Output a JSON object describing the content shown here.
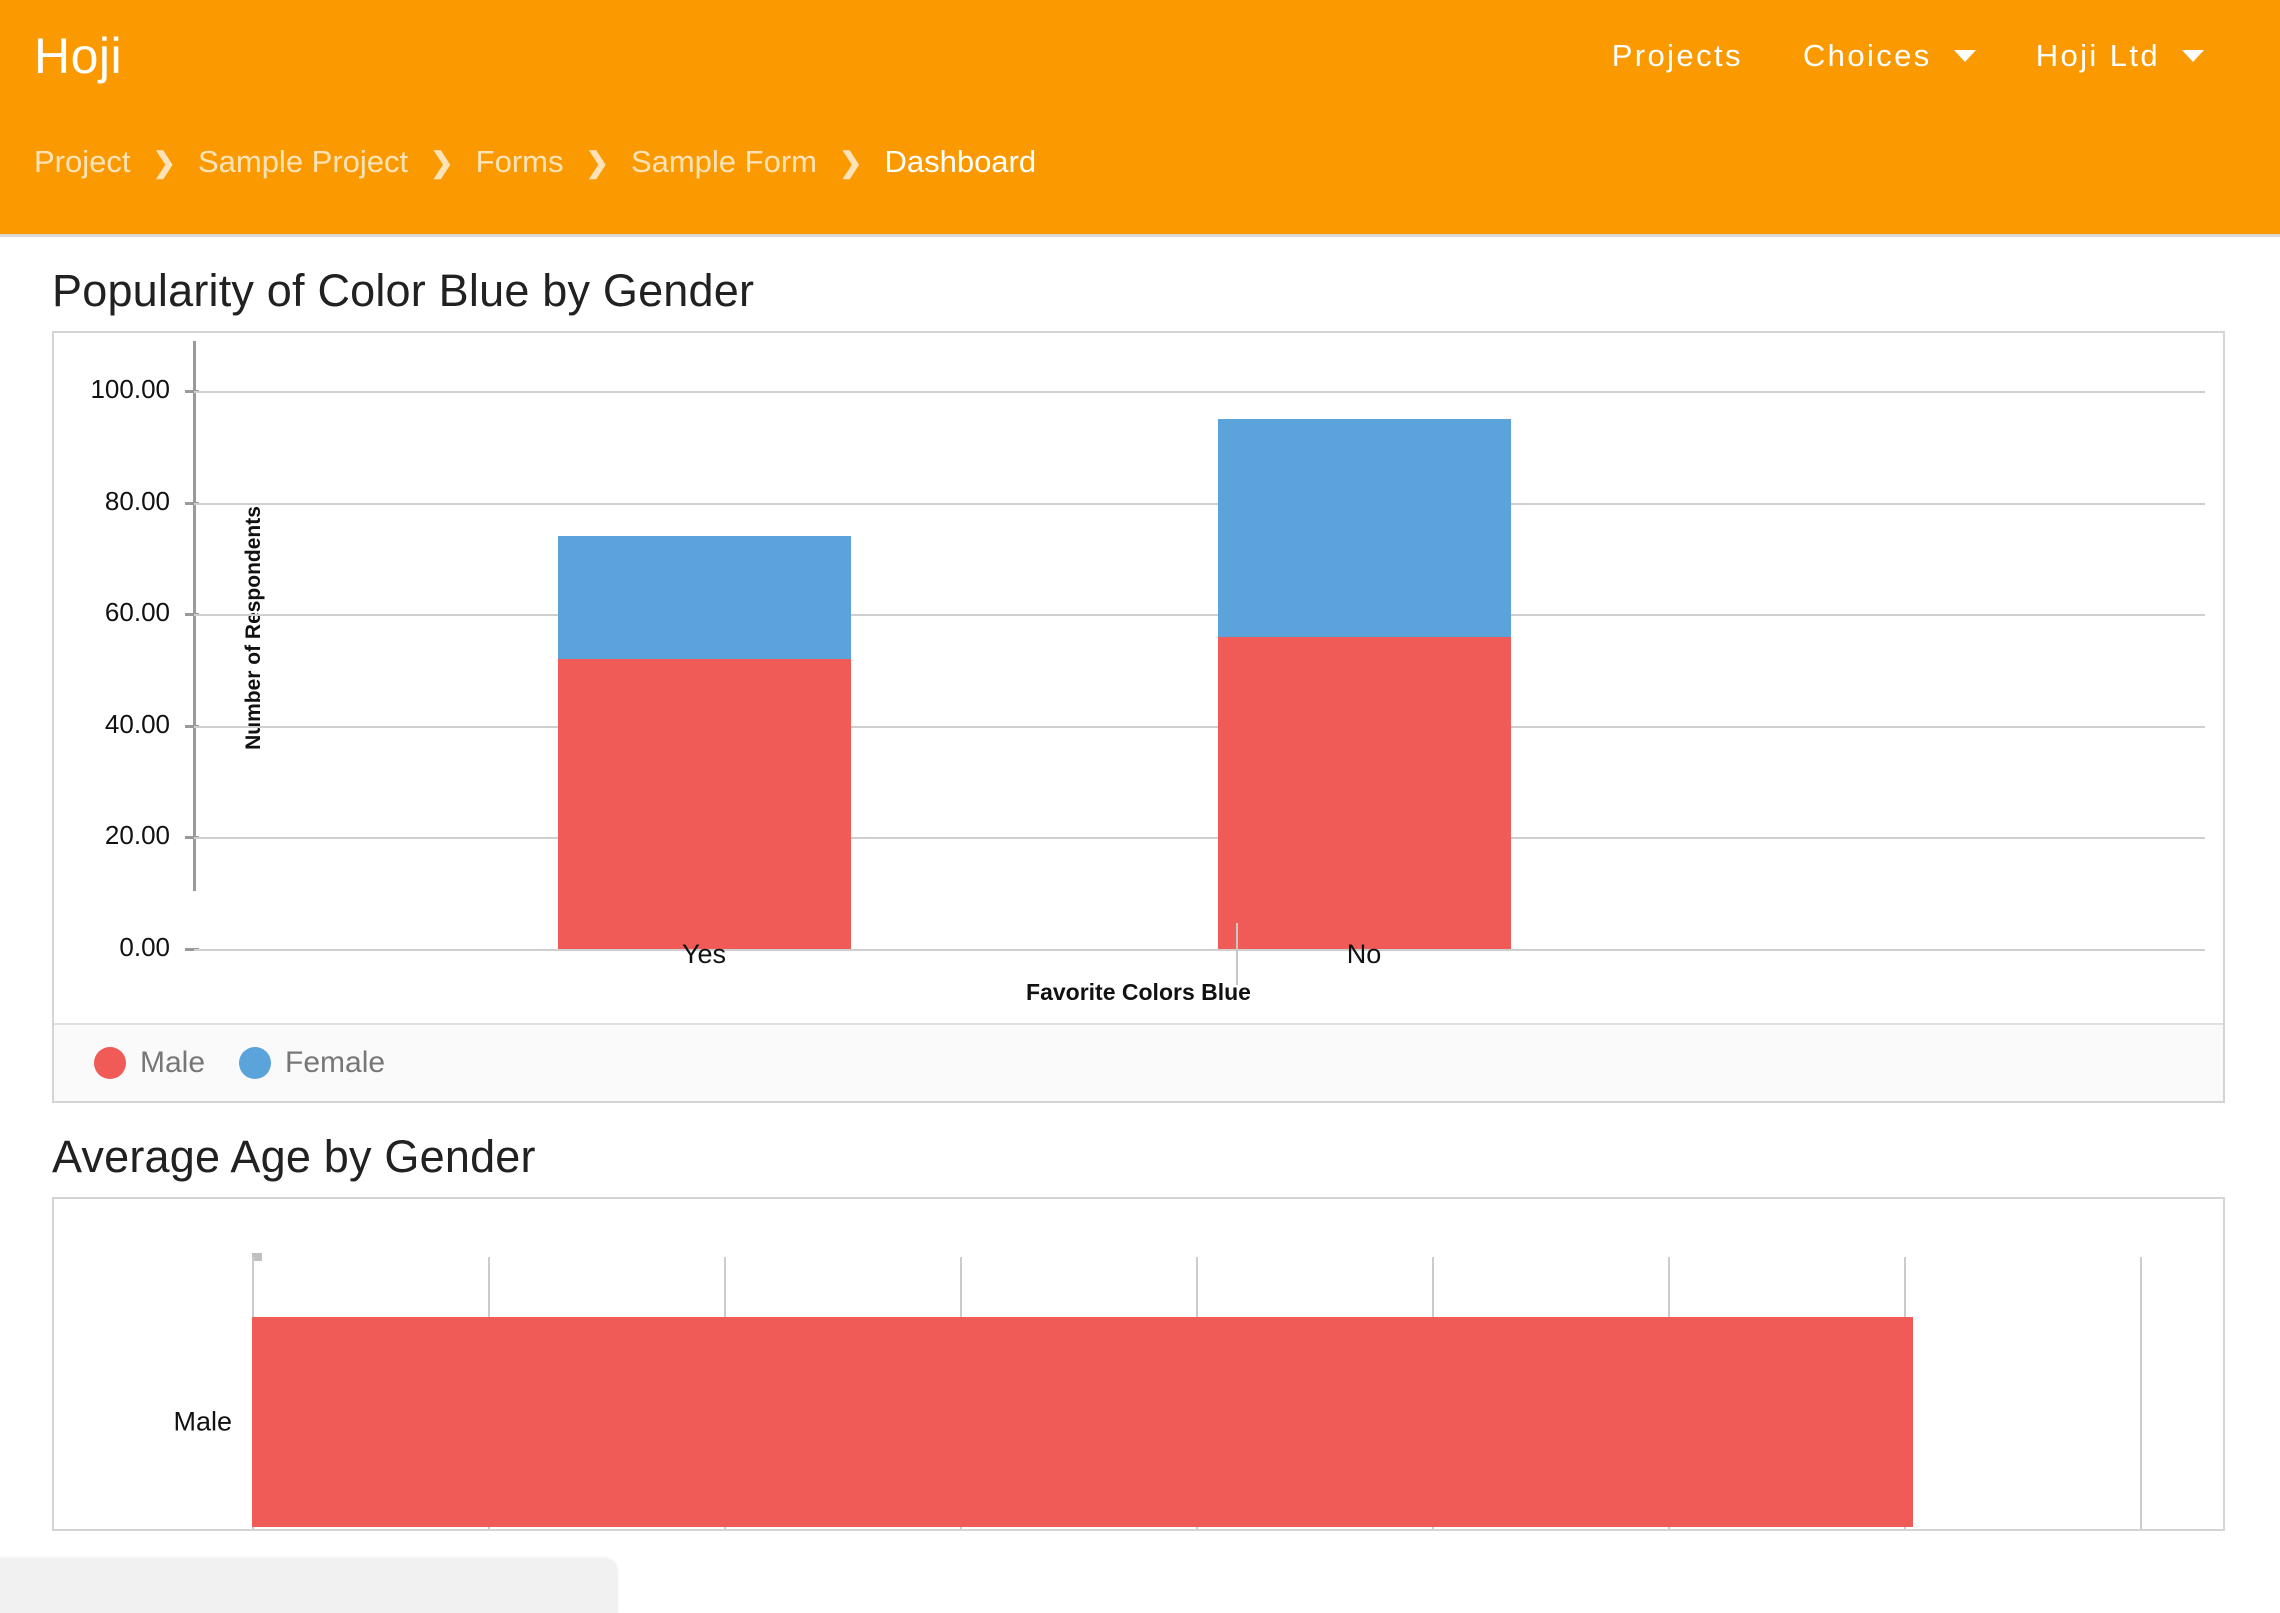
{
  "header": {
    "brand": "Hoji",
    "accent_color": "#FB9A00",
    "nav": [
      {
        "label": "Projects",
        "has_caret": false
      },
      {
        "label": "Choices",
        "has_caret": true
      },
      {
        "label": "Hoji Ltd",
        "has_caret": true
      }
    ],
    "breadcrumb": {
      "separator": "❯",
      "items": [
        {
          "label": "Project",
          "current": false
        },
        {
          "label": "Sample Project",
          "current": false
        },
        {
          "label": "Forms",
          "current": false
        },
        {
          "label": "Sample Form",
          "current": false
        },
        {
          "label": "Dashboard",
          "current": true
        }
      ]
    }
  },
  "sections": [
    {
      "title": "Popularity of Color Blue by Gender"
    },
    {
      "title": "Average Age by Gender"
    }
  ],
  "chart_data": [
    {
      "type": "bar",
      "orientation": "vertical",
      "stacked": true,
      "title": "Popularity of Color Blue by Gender",
      "xlabel": "Favorite Colors Blue",
      "ylabel": "Number of Respondents",
      "categories": [
        "Yes",
        "No"
      ],
      "yticks": [
        "0.00",
        "20.00",
        "40.00",
        "60.00",
        "80.00",
        "100.00"
      ],
      "ytick_values": [
        0,
        20,
        40,
        60,
        80,
        100
      ],
      "ylim": [
        0,
        100
      ],
      "grid": true,
      "legend_position": "bottom-left",
      "series": [
        {
          "name": "Male",
          "color": "#F05B57",
          "values": [
            52,
            56
          ]
        },
        {
          "name": "Female",
          "color": "#5BA3DB",
          "values": [
            22,
            39
          ]
        }
      ],
      "totals": [
        74,
        95
      ]
    },
    {
      "type": "bar",
      "orientation": "horizontal",
      "stacked": false,
      "title": "Average Age by Gender",
      "xlabel": "",
      "ylabel": "",
      "categories": [
        "Male"
      ],
      "grid": true,
      "gridline_count": 9,
      "series": [
        {
          "name": "Male",
          "color": "#F05B57",
          "values": [
            88
          ]
        }
      ],
      "xlim": [
        0,
        100
      ]
    }
  ],
  "status_panel": {
    "visible": true,
    "color": "#F1F1F1"
  }
}
